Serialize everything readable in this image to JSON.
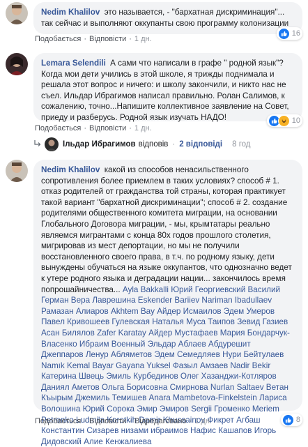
{
  "comments": [
    {
      "author": "Nedim Khalilov",
      "text": "это называется, - \"бархатная дискриминация\"... так сейчас и выполняют оккупанты свою программу колонизации",
      "actions": {
        "like": "Подобається",
        "reply": "Відповісти",
        "time": "1 дн."
      },
      "reactions_count": "16"
    },
    {
      "author": "Lemara Selendili",
      "text": "А сами что написали в графе \" родной язык\"? Когда мои дети учились в этой школе, я трижды поднимала и решала этот вопрос и ничего: и школу закончили, и никто нас не съел. Ильдар Ибрагимов написал правильно. Ролан Салимов, к сожалению, точно...Напишите коллективное заявление на Совет, приеду и разберусь. Родной язык изучать НАДО!",
      "actions": {
        "like": "Подобається",
        "reply": "Відповісти",
        "time": "1 дн."
      },
      "reactions_count": "10"
    },
    {
      "author": "Nedim Khalilov",
      "text": "какой из способов ненасильственного сопротивления более приемлем в таких условиях? способ # 1. отказ родителей от гражданства той страны, которая практикует такой вариант \"бархатной дискриминации\"; способ # 2. создание родителями общественного комитета миграции, на основании Глобального Договора миграции, - мы, крымтатары реально являемся мигрантами с конца 80х годов прошлого столетия, мигрировав из мест депортации, но мы не получили восстановленного своего права, в т.ч. по родному языку, дети вынуждены обучаться на языке оккупантов, что однозначно ведет к утере родного языка и деградации нации... закончилось время попрошайничества...",
      "mentions": "Ayla Bakkalli Юрий Георгиевский Василий Герман Вера Лаврешина Eskender Bariiev Nariman Ibadullaev Рамазан Алиаров Akhtem Bay Айдер Исмаилов Эдем Умеров Павел Кривошеев Гулевская Наталья Муса Таипов Зевид Газиев Асан Билялов Zafer Karatay Айдер Мустафаев Мария Бондарчук-Власенко Ибраим Военный Эльдар Аблаев Абдурешит Джеппаров Ленур Абляметов Эдем Семедляев Нури Бейтулаев Namık Kemal Bayar Gayana Yuksel Фазыл Амзаев Nadir Bekir Катерина Швець Эмиль Курбединов Олег Хазанджи-Котляров Даниял Аметов Ольга Борисовна Смирнова Nurlan Saltaev Ветан Къырым Джемиль Темишев Anara Mambetova-Finkelstein Лариса Волошина Юрий Сорока Эмир Эмиров Sergii Громенко Meriem Petrenko Ludmila Korotkih Damir Khussainov Фикрет Агбаш Константин Сизарев низами ибраимов Нафис Кашапов Игорь Дидовский Алие Кенжалиева",
      "actions": {
        "like": "Подобається",
        "reply": "Відповісти",
        "edited": "Відредаговано",
        "time": "1 дн."
      },
      "reactions_count": "8"
    }
  ],
  "reply_row": {
    "author": "Ільдар Ибрагимов",
    "verb": "відповів",
    "count": "2 відповіді",
    "time": "8 год"
  },
  "colors": {
    "link": "#385898",
    "bubble": "#f2f3f5",
    "like": "#1877f2"
  }
}
